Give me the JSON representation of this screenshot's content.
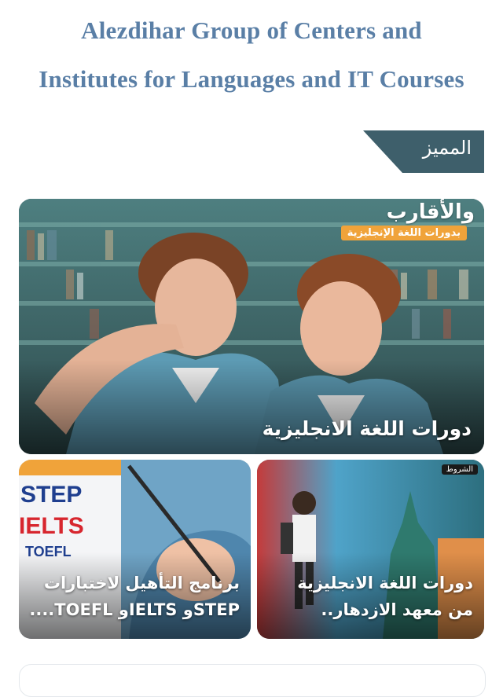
{
  "header": {
    "title_line1": "Alezdihar Group of Centers and",
    "title_line2": "Institutes for Languages and IT Courses"
  },
  "section": {
    "title": "المميز"
  },
  "cards": [
    {
      "caption": "دورات اللغة الانجليزية",
      "brand_text": "والأقارب",
      "badge_text": "بدورات اللغة الإنجليزية"
    },
    {
      "caption_line1": "برنامج التأهيل لاختبارات",
      "caption_line2": "STEPو IELTSو TOEFL....",
      "image_texts": [
        "STEP",
        "IELTS",
        "TOEFL"
      ]
    },
    {
      "caption_line1": "دورات اللغة الانجليزية",
      "caption_line2": "من معهد الازدهار..",
      "tag_text": "الشروط"
    }
  ],
  "colors": {
    "title": "#5a7fa6",
    "section_tab": "#3e5f6b",
    "badge": "#f0a33a"
  }
}
